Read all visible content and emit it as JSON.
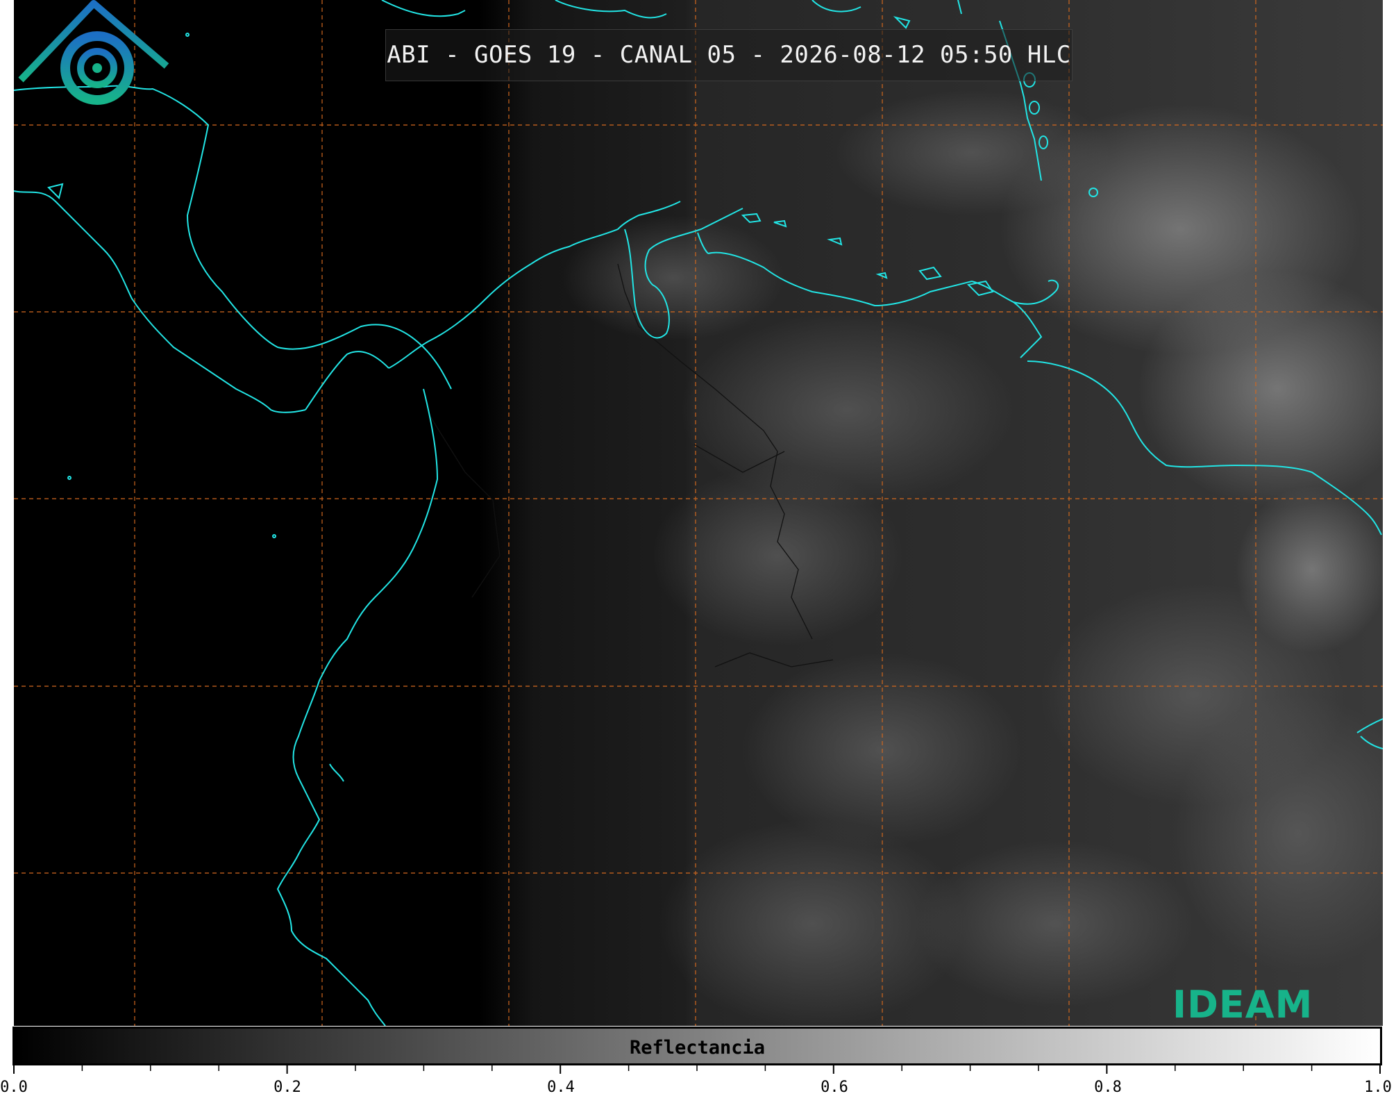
{
  "title": "ABI - GOES 19 - CANAL 05 - 2026-08-12 05:50 HLC",
  "colorbar": {
    "label": "Reflectancia",
    "range": [
      0.0,
      1.0
    ],
    "colormap": "gray",
    "major_ticks": [
      "0.0",
      "0.2",
      "0.4",
      "0.6",
      "0.8",
      "1.0"
    ],
    "minor_tick_step": 0.05
  },
  "logo": {
    "text": "IDEAM",
    "icon": "ideam-mountain-spiral-logo"
  },
  "colors": {
    "coastline": "#22e5e5",
    "gridlines": "#d2691e",
    "background": "#000000",
    "logo_green": "#17b38a",
    "logo_blue": "#1c6fc4"
  }
}
